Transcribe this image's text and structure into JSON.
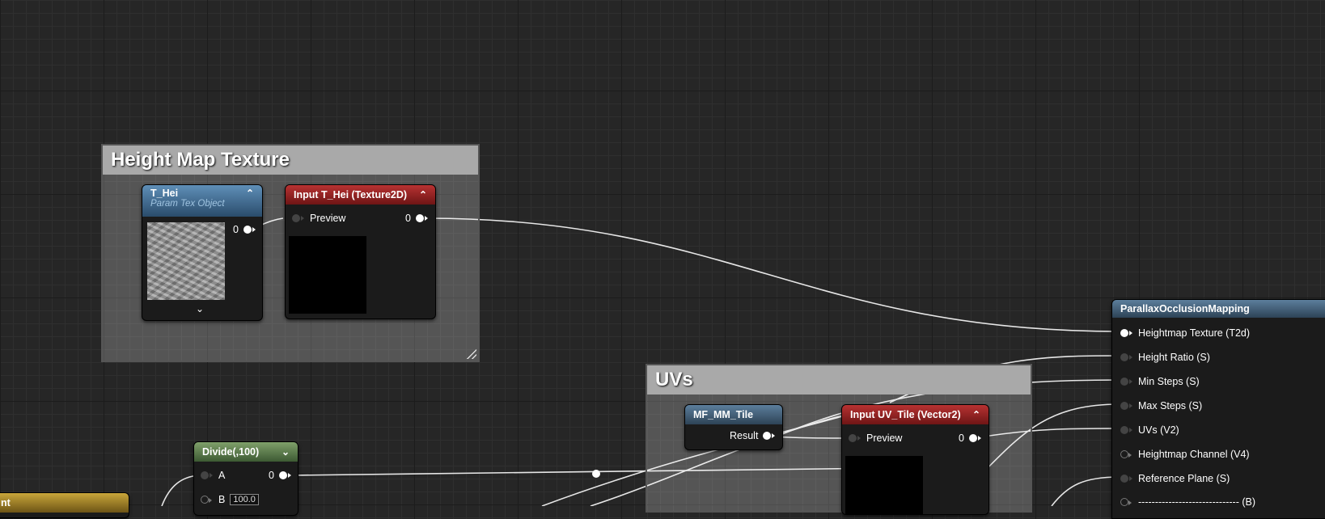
{
  "comments": {
    "height_map": "Height Map Texture",
    "uvs": "UVs"
  },
  "t_hei": {
    "title": "T_Hei",
    "subtitle": "Param Tex Object",
    "output": "0"
  },
  "input_t_hei": {
    "title": "Input T_Hei (Texture2D)",
    "preview": "Preview",
    "output": "0"
  },
  "pom": {
    "title": "ParallaxOcclusionMapping",
    "inputs": [
      "Heightmap Texture (T2d)",
      "Height Ratio (S)",
      "Min Steps (S)",
      "Max Steps (S)",
      "UVs (V2)",
      "Heightmap Channel (V4)",
      "Reference Plane (S)",
      "------------------------------ (B)"
    ]
  },
  "mf_tile": {
    "title": "MF_MM_Tile",
    "result": "Result"
  },
  "input_uv_tile": {
    "title": "Input UV_Tile (Vector2)",
    "preview": "Preview",
    "output": "0"
  },
  "divide": {
    "title": "Divide(,100)",
    "a": "A",
    "b": "B",
    "b_value": "100.0",
    "output": "0"
  },
  "partial_node": {
    "title": "nt"
  },
  "icons": {
    "collapse": "chevron-up-icon",
    "expand": "chevron-down-icon",
    "resize": "resize-grip-icon"
  },
  "colors": {
    "background": "#262626",
    "header_blue": "#3f6d93",
    "header_red": "#9e2222",
    "header_green": "#5b7a4d",
    "wire": "#e6e6e6"
  }
}
